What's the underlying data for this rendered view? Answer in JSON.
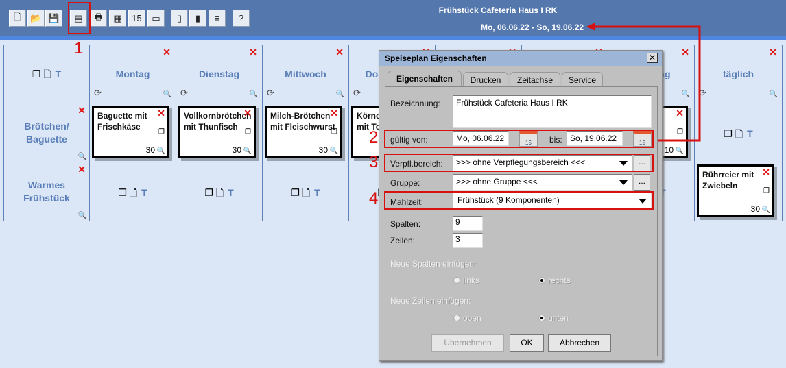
{
  "header": {
    "title": "Frühstück Cafeteria Haus I RK",
    "date_range": "Mo, 06.06.22 - So, 19.06.22"
  },
  "toolbar": [
    {
      "icon": "new-document-icon",
      "g": "🗋"
    },
    {
      "icon": "open-folder-icon",
      "g": "📂"
    },
    {
      "icon": "save-icon",
      "g": "💾"
    },
    {
      "icon": "properties-icon",
      "g": "▤"
    },
    {
      "icon": "print-icon",
      "g": "🖶"
    },
    {
      "icon": "table-icon",
      "g": "▦"
    },
    {
      "icon": "calendar-icon",
      "g": "15"
    },
    {
      "icon": "display-icon",
      "g": "▭"
    },
    {
      "icon": "notebook-icon",
      "g": "▯"
    },
    {
      "icon": "chart-icon",
      "g": "▮"
    },
    {
      "icon": "abacus-icon",
      "g": "≡"
    },
    {
      "icon": "help-icon",
      "g": "?"
    }
  ],
  "grid": {
    "tools": {
      "copy": "❐",
      "page": "🗋",
      "text": "T"
    },
    "columns": [
      "Montag",
      "Dienstag",
      "Mittwoch",
      "Donnerstag",
      "",
      "",
      "Sonntag",
      "täglich"
    ],
    "rows": [
      {
        "label": "Brötchen/ Baguette",
        "cards": [
          {
            "col": 0,
            "text": "Baguette mit\nFrischkäse",
            "count": "30"
          },
          {
            "col": 1,
            "text": "Vollkornbrötchen\nmit Thunfisch",
            "count": "30"
          },
          {
            "col": 2,
            "text": "Milch-Brötchen\nmit Fleischwurst",
            "count": "30"
          },
          {
            "col": 3,
            "text": "Körne\nmit To",
            "count": ""
          },
          {
            "col": 6,
            "text": "",
            "count": "10"
          }
        ]
      },
      {
        "label": "Warmes Frühstück",
        "cards": [
          {
            "col": 7,
            "text": "Rührreier mit\nZwiebeln",
            "count": "30"
          }
        ]
      }
    ]
  },
  "dialog": {
    "title": "Speiseplan Eigenschaften",
    "tabs": [
      "Eigenschaften",
      "Drucken",
      "Zeitachse",
      "Service"
    ],
    "bezeichnung_label": "Bezeichnung:",
    "bezeichnung": "Frühstück Cafeteria Haus I RK",
    "von_label": "gültig von:",
    "von": "Mo, 06.06.22",
    "bis_label": "bis:",
    "bis": "So, 19.06.22",
    "cal_day": "15",
    "bereich_label": "Verpfl.bereich:",
    "bereich": ">>> ohne Verpflegungsbereich <<<",
    "gruppe_label": "Gruppe:",
    "gruppe": ">>> ohne Gruppe <<<",
    "mahlzeit_label": "Mahlzeit:",
    "mahlzeit": "Frühstück (9 Komponenten)",
    "more": "...",
    "spalten_label": "Spalten:",
    "spalten": "9",
    "zeilen_label": "Zeilen:",
    "zeilen": "3",
    "neue_spalten": "Neue Spalten einfügen:",
    "links": "links",
    "rechts": "rechts",
    "neue_zeilen": "Neue Zeilen einfügen:",
    "oben": "oben",
    "unten": "unten",
    "apply": "Übernehmen",
    "ok": "OK",
    "cancel": "Abbrechen"
  },
  "annotations": [
    "1",
    "2",
    "3",
    "4"
  ]
}
